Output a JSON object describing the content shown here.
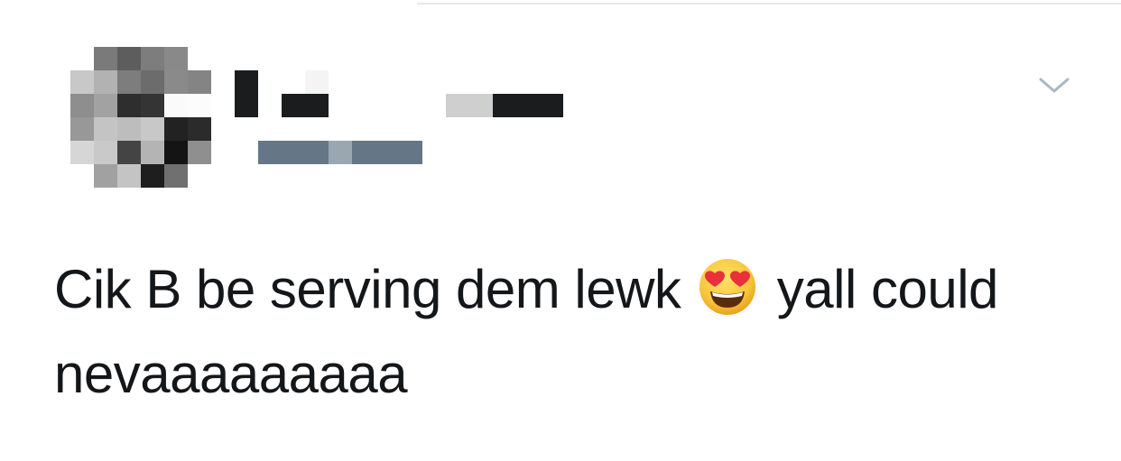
{
  "tweet": {
    "text_before_emoji": "Cik B be serving dem lewk ",
    "emoji": {
      "icon": "smiling-face-with-heart-eyes-icon",
      "char": "😍",
      "face_color": "#f7c63b",
      "heart_color": "#e8313a"
    },
    "text_after_emoji": " yall could nevaaaaaaaaa"
  },
  "author": {
    "avatar_state": "pixelated",
    "name_state": "redacted",
    "handle_state": "redacted"
  },
  "menu": {
    "icon": "chevron-down-icon"
  },
  "colors": {
    "text": "#14171a",
    "chevron": "#aab8c2",
    "handle_redaction": "#657786",
    "divider": "#e1e8ed"
  }
}
